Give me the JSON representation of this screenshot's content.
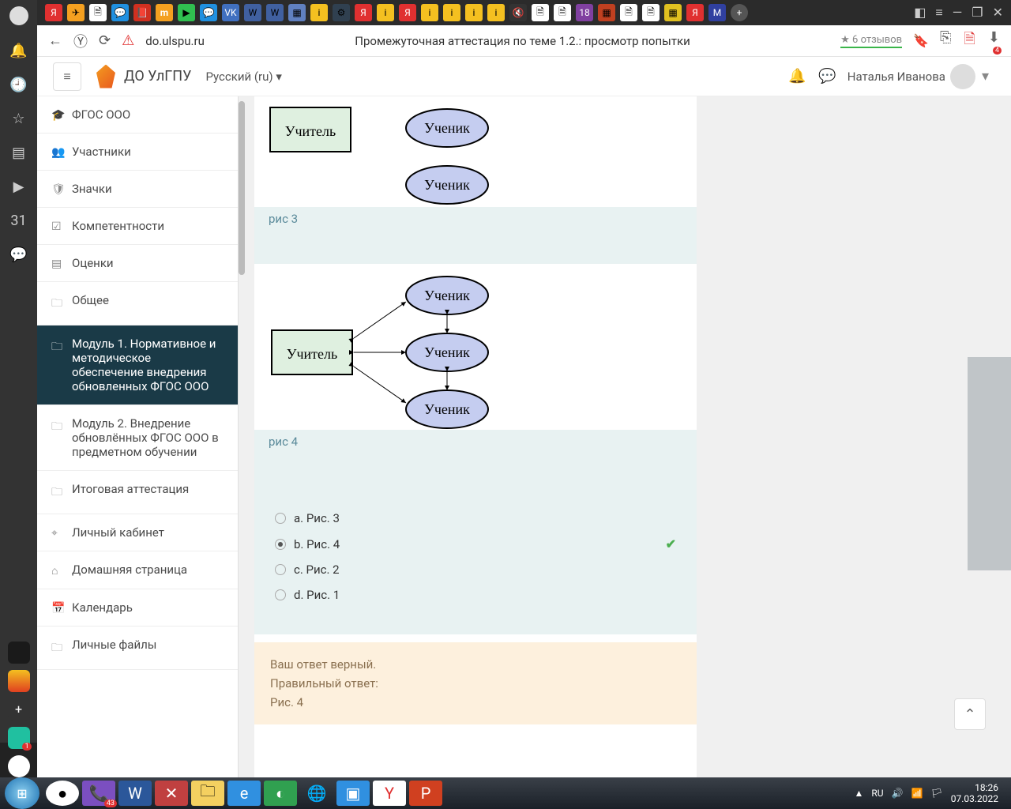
{
  "browser": {
    "url": "do.ulspu.ru",
    "title": "Промежуточная аттестация по теме 1.2.: просмотр попытки",
    "reviews": "★ 6 отзывов"
  },
  "moodle": {
    "site_name": "ДО УлГПУ",
    "lang": "Русский (ru)",
    "user": "Наталья Иванова"
  },
  "sidenav": {
    "items": [
      {
        "icon": "🎓",
        "label": "ФГОС ООО"
      },
      {
        "icon": "👥",
        "label": "Участники"
      },
      {
        "icon": "🛡",
        "label": "Значки"
      },
      {
        "icon": "☑",
        "label": "Компетентности"
      },
      {
        "icon": "▤",
        "label": "Оценки"
      },
      {
        "icon": "🗀",
        "label": "Общее"
      },
      {
        "icon": "🗀",
        "label": "Модуль 1. Нормативное и методическое обеспечение внедрения обновленных ФГОС ООО",
        "active": true
      },
      {
        "icon": "🗀",
        "label": "Модуль 2. Внедрение обновлённых ФГОС ООО в предметном обучении"
      },
      {
        "icon": "🗀",
        "label": "Итоговая аттестация"
      },
      {
        "icon": "⌖",
        "label": "Личный кабинет"
      },
      {
        "icon": "⌂",
        "label": "Домашняя страница"
      },
      {
        "icon": "📅",
        "label": "Календарь"
      },
      {
        "icon": "🗀",
        "label": "Личные файлы"
      }
    ]
  },
  "question": {
    "fig3_label": "рис 3",
    "fig4_label": "рис 4",
    "teacher": "Учитель",
    "student": "Ученик",
    "answers": [
      {
        "label": "a. Рис. 3",
        "selected": false,
        "correct": false
      },
      {
        "label": "b. Рис. 4",
        "selected": true,
        "correct": true
      },
      {
        "label": "c. Рис. 2",
        "selected": false,
        "correct": false
      },
      {
        "label": "d. Рис. 1",
        "selected": false,
        "correct": false
      }
    ],
    "feedback_correct": "Ваш ответ верный.",
    "feedback_right_label": "Правильный ответ:",
    "feedback_right_value": "Рис. 4"
  },
  "tray": {
    "lang": "RU",
    "time": "18:26",
    "date": "07.03.2022"
  },
  "download_badge": "4",
  "viber_badge": "43",
  "tb_badge": "1"
}
